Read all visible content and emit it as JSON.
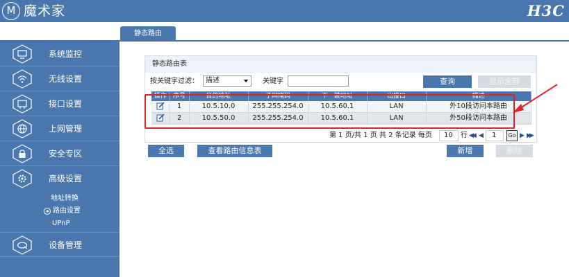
{
  "header": {
    "logo_letter": "M",
    "brand": "魔术家",
    "vendor": "H3C"
  },
  "tab": {
    "label": "静态路由"
  },
  "sidebar": {
    "items": [
      {
        "label": "系统监控",
        "icon": "monitor-icon"
      },
      {
        "label": "无线设置",
        "icon": "wifi-icon"
      },
      {
        "label": "接口设置",
        "icon": "interface-icon"
      },
      {
        "label": "上网管理",
        "icon": "globe-icon"
      },
      {
        "label": "安全专区",
        "icon": "lock-icon"
      },
      {
        "label": "高级设置",
        "icon": "gear-icon"
      },
      {
        "label": "设备管理",
        "icon": "device-icon"
      }
    ],
    "subitems": [
      "地址转换",
      "路由设置",
      "UPnP"
    ]
  },
  "panel": {
    "title": "静态路由表"
  },
  "filter": {
    "label": "按关键字过滤：",
    "select_value": "描述",
    "keyword_label": "关键字",
    "keyword_value": "",
    "query_button": "查询",
    "show_all_button": "显示全部"
  },
  "table": {
    "headers": [
      "操作",
      "序号",
      "目的地址",
      "子网掩码",
      "下一跳地址",
      "出接口",
      "描述"
    ],
    "rows": [
      {
        "index": "1",
        "dest": "10.5.10.0",
        "mask": "255.255.254.0",
        "next_hop": "10.5.60.1",
        "iface": "LAN",
        "desc": "外10段访问本路由"
      },
      {
        "index": "2",
        "dest": "10.5.50.0",
        "mask": "255.255.254.0",
        "next_hop": "10.5.60.1",
        "iface": "LAN",
        "desc": "外50段访问本路由"
      }
    ]
  },
  "pager": {
    "summary": "第 1 页/共 1 页 共 2 条记录 每页",
    "page_size": "10",
    "page_size_label": "行",
    "current_page": "1",
    "go_label": "Go"
  },
  "actions": {
    "select_all": "全选",
    "view_info": "查看路由信息表",
    "add": "新增",
    "delete": "删除"
  },
  "colors": {
    "brand_blue": "#4a77ad",
    "highlight_red": "#e02424"
  }
}
